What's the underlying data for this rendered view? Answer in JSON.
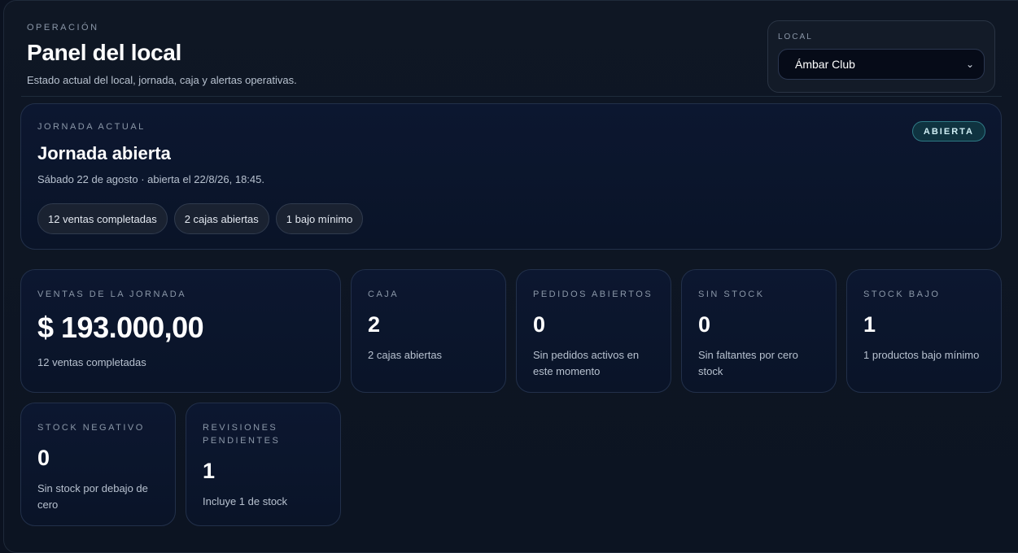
{
  "header": {
    "eyebrow": "OPERACIÓN",
    "title": "Panel del local",
    "subtitle": "Estado actual del local, jornada, caja y alertas operativas."
  },
  "local": {
    "label": "LOCAL",
    "selected": "Ámbar Club"
  },
  "jornada": {
    "eyebrow": "JORNADA ACTUAL",
    "title": "Jornada abierta",
    "subtitle": "Sábado 22 de agosto · abierta el 22/8/26, 18:45.",
    "badge": "ABIERTA",
    "pills": [
      "12 ventas completadas",
      "2 cajas abiertas",
      "1 bajo mínimo"
    ]
  },
  "metrics": [
    {
      "label": "VENTAS DE LA JORNADA",
      "value": "$ 193.000,00",
      "sub": "12 ventas completadas"
    },
    {
      "label": "CAJA",
      "value": "2",
      "sub": "2 cajas abiertas"
    },
    {
      "label": "PEDIDOS ABIERTOS",
      "value": "0",
      "sub": "Sin pedidos activos en este momento"
    },
    {
      "label": "SIN STOCK",
      "value": "0",
      "sub": "Sin faltantes por cero stock"
    },
    {
      "label": "STOCK BAJO",
      "value": "1",
      "sub": "1 productos bajo mínimo"
    },
    {
      "label": "STOCK NEGATIVO",
      "value": "0",
      "sub": "Sin stock por debajo de cero"
    },
    {
      "label": "REVISIONES PENDIENTES",
      "value": "1",
      "sub": "Incluye 1 de stock"
    }
  ],
  "colors": {
    "background": "#0b1220",
    "card": "#0c1730",
    "badge_bg": "#0f3340",
    "badge_border": "#2f7a86"
  }
}
